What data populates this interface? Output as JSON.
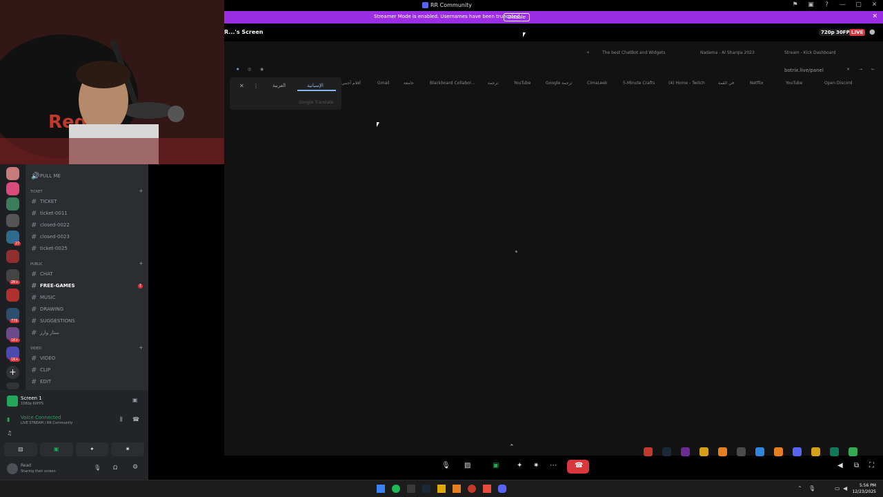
{
  "window": {
    "title": "RR Community",
    "controls": [
      "minimize",
      "maximize",
      "close"
    ]
  },
  "streamer_banner": {
    "text": "Streamer Mode is enabled. Usernames have been truncated.",
    "button_label": "Disable"
  },
  "stream": {
    "title": "R...'s Screen",
    "quality": "720p 30FPS",
    "live": "LIVE"
  },
  "browser": {
    "tabs": [
      "The best ChatBot and Widgets",
      "Nadama - Al Sharqia 2023",
      "Stream - Kick Dashboard"
    ],
    "url": "botrix.live/panel",
    "bookmarks": [
      "أفلام أجنبي",
      "Gmail",
      "جامعة",
      "Blackboard Collabor...",
      "ترجمة",
      "YouTube",
      "Google ترجمة",
      "CimaLeek",
      "5-Minute Crafts",
      "(4) Home - Twitch",
      "في القمة",
      "Netflix",
      "YouTube",
      "Open Discord"
    ],
    "translate_popup": {
      "lang_source": "العربية",
      "lang_target": "الإسبانية",
      "footer": "Google Translate"
    }
  },
  "sidebar": {
    "top_item": "PULL ME",
    "categories": [
      {
        "name": "TICKET",
        "channels": [
          "TICKET",
          "ticket-0011",
          "closed-0022",
          "closed-0023",
          "ticket-0025"
        ]
      },
      {
        "name": "PUBLIC",
        "channels": [
          "CHAT",
          "FREE-GAMES",
          "MUSIC",
          "DRAWING",
          "SUGGESTIONS",
          "ستار وارز"
        ]
      },
      {
        "name": "VIDEO",
        "channels": [
          "VIDEO",
          "CLIP",
          "EDIT"
        ]
      }
    ],
    "unread_count": "1",
    "server_badges": [
      "27",
      "2K+",
      "776",
      "1K+",
      "1K+"
    ]
  },
  "voice_panel": {
    "screen_label": "Screen 1",
    "screen_sub": "1080p 60FPS",
    "voice_status": "Voice Connected",
    "voice_channel": "LIVE STREAM / RR Community",
    "user_name": "Read",
    "user_status": "Sharing their screen"
  },
  "taskbar": {
    "time": "5:56 PM",
    "date": "12/23/2025"
  },
  "colors": {
    "banner": "#9b2ee5",
    "accent": "#5865f2",
    "danger": "#da373c",
    "voice_green": "#23a55a"
  }
}
